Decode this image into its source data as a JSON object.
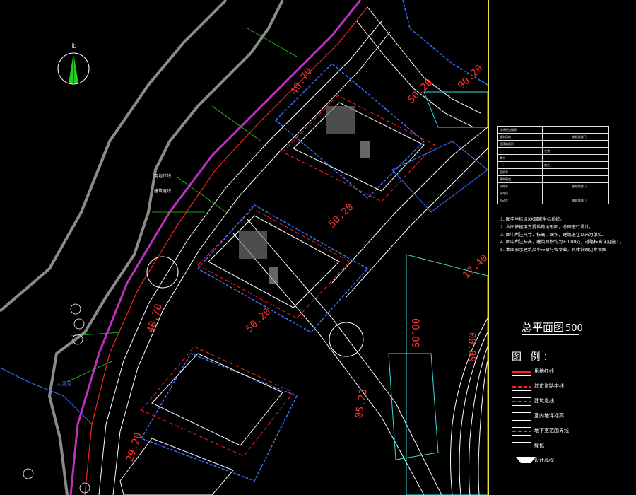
{
  "drawing": {
    "title": "总平面图",
    "scale": "500",
    "north": "北"
  },
  "tech_table": {
    "rows": [
      [
        "技术经济指标",
        "",
        "",
        ""
      ],
      [
        "规划用地",
        "",
        "",
        "按规划部门"
      ],
      [
        "总建筑面积",
        "",
        "",
        ""
      ],
      [
        "",
        "住宅",
        "",
        ""
      ],
      [
        "其中",
        "",
        "",
        ""
      ],
      [
        "",
        "商业",
        "",
        ""
      ],
      [
        "容积率",
        "",
        "",
        ""
      ],
      [
        "建筑密度",
        "",
        "",
        ""
      ],
      [
        "绿地率",
        "",
        "",
        "按规划部门"
      ],
      [
        "停车位",
        "",
        "",
        ""
      ],
      [
        "机动车",
        "",
        "",
        "按规划部门"
      ]
    ]
  },
  "notes": [
    "1. 图中坐标以XX国家坐标系统。",
    "2. 本图依据甲方提供的地形图，总图进行设计。",
    "3. 图中所注尺寸、标高、面积，建筑退让以米为单位。",
    "4. 图中所注标高，建筑面积均为±0.00处，道路标高详见施工。",
    "5. 本图表示建筑及小市政与各专业，具体详图见专项图"
  ],
  "legend": {
    "heading": "图 例：",
    "items": [
      {
        "label": "用地红线",
        "color": "#ff2020",
        "style": "solid"
      },
      {
        "label": "城市道路中线",
        "color": "#ff2020",
        "style": "dashdot"
      },
      {
        "label": "建筑退线",
        "color": "#ff2020",
        "style": "dash"
      },
      {
        "label": "室内地坪标高",
        "color": "#ffffff",
        "style": "box"
      },
      {
        "label": "地下室范围界线",
        "color": "#3a73ff",
        "style": "dash"
      },
      {
        "label": "绿化",
        "color": "#ffffff",
        "style": "box"
      },
      {
        "label": "设计高程",
        "color": "#ffffff",
        "style": "arrow"
      }
    ]
  },
  "map_labels": {
    "red_line": "用地红线",
    "setback": "建筑退线",
    "river": "大溪河"
  },
  "dimensions": [
    "40.70",
    "50.20",
    "50.20",
    "50.20",
    "40.70",
    "29.20",
    "90.20",
    "17.40",
    "00.09",
    "00.09",
    "05.23"
  ],
  "colors": {
    "background": "#000000",
    "road": "#ffffff",
    "red_line": "#ff2020",
    "magenta": "#c030c0",
    "blue": "#3a73ff",
    "green": "#22cc22",
    "cyan": "#33dddd",
    "yellow": "#e8e84a",
    "gray": "#8a8a8a"
  }
}
